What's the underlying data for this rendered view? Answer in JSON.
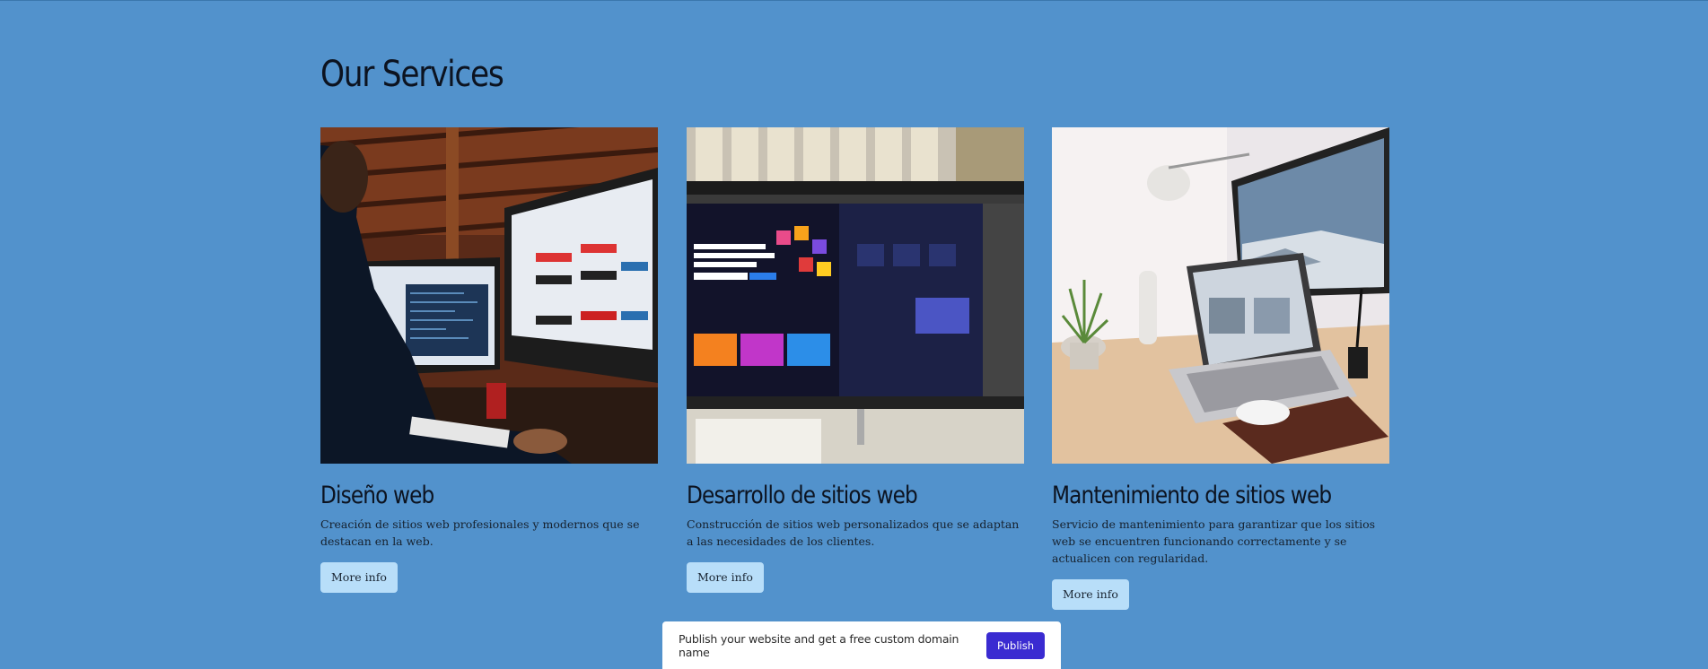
{
  "page": {
    "title": "Our Services",
    "background_color": "#5292cc"
  },
  "services": [
    {
      "title": "Diseño web",
      "description": "Creación de sitios web profesionales y modernos que se destacan en la web.",
      "button_label": "More info",
      "image_icon": "designer-at-imac-photo"
    },
    {
      "title": "Desarrollo de sitios web",
      "description": "Construcción de sitios web personalizados que se adaptan a las necesidades de los clientes.",
      "button_label": "More info",
      "image_icon": "photoshop-monitor-photo"
    },
    {
      "title": "Mantenimiento de sitios web",
      "description": "Servicio de mantenimiento para garantizar que los sitios web se encuentren funcionando correctamente y se actualicen con regularidad.",
      "button_label": "More info",
      "image_icon": "laptop-desk-photo"
    }
  ],
  "publish_bar": {
    "text": "Publish your website and get a free custom domain name",
    "button_label": "Publish",
    "button_color": "#3a2bd1"
  },
  "colors": {
    "button_bg": "#b8def9",
    "heading": "#0c1320"
  }
}
